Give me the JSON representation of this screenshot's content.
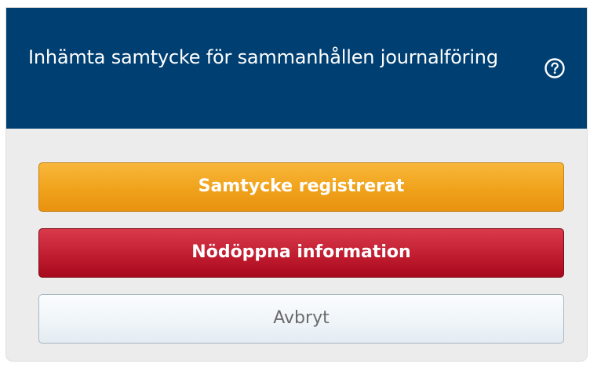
{
  "dialog": {
    "title": "Inhämta samtycke för sammanhållen journalföring",
    "help_icon": "question-circle-icon",
    "colors": {
      "header": "#003f72",
      "body": "#ececec",
      "primary_orange": "#f0a21b",
      "danger_red": "#c11d31",
      "secondary_light": "#eef4f8"
    }
  },
  "actions": {
    "consent_registered": "Samtycke registrerat",
    "emergency_open": "Nödöppna information",
    "cancel": "Avbryt"
  }
}
